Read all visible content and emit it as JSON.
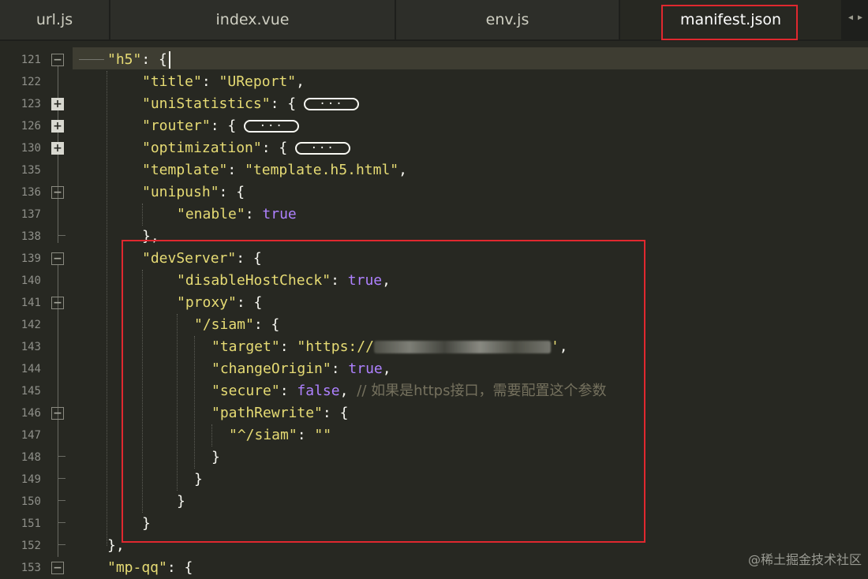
{
  "tabs": [
    {
      "label": "url.js",
      "active": false
    },
    {
      "label": "index.vue",
      "active": false
    },
    {
      "label": "env.js",
      "active": false
    },
    {
      "label": "manifest.json",
      "active": true
    }
  ],
  "tab_scroll_icons": [
    "arrow-left-icon",
    "arrow-right-icon"
  ],
  "line_numbers": [
    "121",
    "122",
    "123",
    "126",
    "130",
    "135",
    "136",
    "137",
    "138",
    "139",
    "140",
    "141",
    "142",
    "143",
    "144",
    "145",
    "146",
    "147",
    "148",
    "149",
    "150",
    "151",
    "152",
    "153"
  ],
  "code": {
    "l121": {
      "key": "\"h5\"",
      "punct": ": {"
    },
    "l122": {
      "key": "\"title\"",
      "colon": ": ",
      "value": "\"UReport\"",
      "end": ","
    },
    "l123": {
      "key": "\"uniStatistics\"",
      "punct": ": {",
      "folded": "···"
    },
    "l126": {
      "key": "\"router\"",
      "punct": ": {",
      "folded": "···"
    },
    "l130": {
      "key": "\"optimization\"",
      "punct": ": {",
      "folded": "···"
    },
    "l135": {
      "key": "\"template\"",
      "colon": ": ",
      "value": "\"template.h5.html\"",
      "end": ","
    },
    "l136": {
      "key": "\"unipush\"",
      "punct": ": {"
    },
    "l137": {
      "key": "\"enable\"",
      "colon": ": ",
      "value": "true"
    },
    "l138": {
      "punct": "},"
    },
    "l139": {
      "key": "\"devServer\"",
      "punct": ": {"
    },
    "l140": {
      "key": "\"disableHostCheck\"",
      "colon": ": ",
      "value": "true",
      "end": ","
    },
    "l141": {
      "key": "\"proxy\"",
      "punct": ": {"
    },
    "l142": {
      "key": "\"/siam\"",
      "punct": ": {"
    },
    "l143": {
      "key": "\"target\"",
      "colon": ": ",
      "value_start": "\"https://",
      "value_end": "'",
      "end": ","
    },
    "l144": {
      "key": "\"changeOrigin\"",
      "colon": ": ",
      "value": "true",
      "end": ","
    },
    "l145": {
      "key": "\"secure\"",
      "colon": ": ",
      "value": "false",
      "end": ", ",
      "comment": "// 如果是https接口，需要配置这个参数"
    },
    "l146": {
      "key": "\"pathRewrite\"",
      "punct": ": {"
    },
    "l147": {
      "key": "\"^/siam\"",
      "colon": ": ",
      "value": "\"\""
    },
    "l148": {
      "punct": "}"
    },
    "l149": {
      "punct": "}"
    },
    "l150": {
      "punct": "}"
    },
    "l151": {
      "punct": "}"
    },
    "l152": {
      "punct": "},"
    },
    "l153": {
      "key": "\"mp-qq\"",
      "punct": ": {"
    }
  },
  "watermark": "@稀土掘金技术社区",
  "colors": {
    "background": "#272822",
    "string": "#e6db74",
    "constant": "#ae81ff",
    "comment": "#75715e",
    "highlight_box": "#e0282f"
  }
}
